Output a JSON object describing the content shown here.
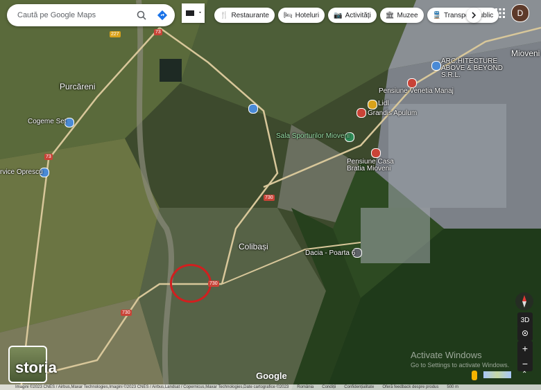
{
  "search": {
    "placeholder": "Caută pe Google Maps"
  },
  "chips": [
    {
      "label": "Restaurante",
      "icon": "fork-knife-icon"
    },
    {
      "label": "Hoteluri",
      "icon": "bed-icon"
    },
    {
      "label": "Activități",
      "icon": "camera-icon"
    },
    {
      "label": "Muzee",
      "icon": "museum-icon"
    },
    {
      "label": "Transport public",
      "icon": "train-icon"
    }
  ],
  "account": {
    "initial": "D"
  },
  "places": {
    "purcareni": "Purcăreni",
    "miovenii": "Mioveni",
    "colibasi": "Colibași",
    "cogeme": "Cogeme Set",
    "opresc": "rvice Oprescu",
    "above": "ARC.HITECTURE ABOVE & BEYOND S.R.L.",
    "venetia": "Pensiune Venetia Manaj",
    "lidl": "Lidl",
    "grandis": "Grandis Apulum",
    "sala": "Sala Sporturilor Mioveni",
    "casa": "Pensiune Casa Bratia Mioveni",
    "dacia": "Dacia - Poarta 6"
  },
  "roads": [
    "227",
    "73",
    "73",
    "730",
    "730",
    "730"
  ],
  "watermark": {
    "line1": "Activate Windows",
    "line2": "Go to Settings to activate Windows."
  },
  "google": "Google",
  "storia": "storia",
  "controls": {
    "view3d": "3D",
    "zoom_in": "+",
    "zoom_out": "−"
  },
  "footer": {
    "attribution": "Imagini ©2023 CNES / Airbus,Maxar Technologies,Imagini ©2023 CNES / Airbus,Landsat / Copernicus,Maxar Technologies,Date cartografice ©2023",
    "country": "România",
    "terms": "Condiții",
    "privacy": "Confidențialitate",
    "feedback": "Oferă feedback despre produs",
    "scale": "500 m"
  },
  "colors": {
    "target_circle": "#d11f1f",
    "pin_red": "#c94337",
    "pin_blue": "#4a8ad6",
    "pin_green": "#2e8b57"
  }
}
